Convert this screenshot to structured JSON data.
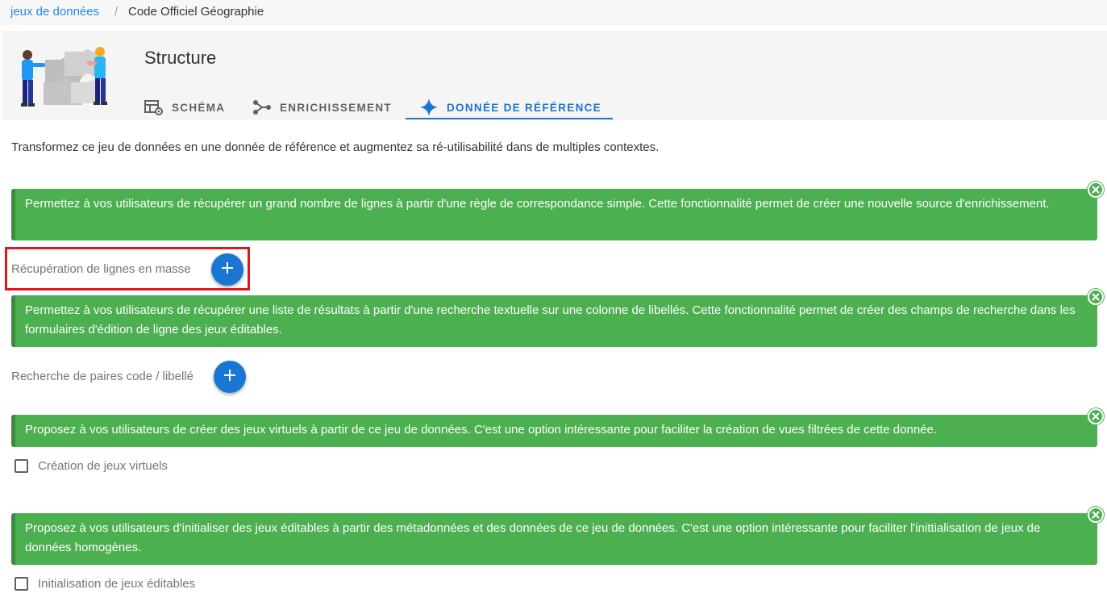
{
  "breadcrumb": {
    "parent": "jeux de données",
    "separator": "/",
    "current": "Code Officiel Géographie"
  },
  "header": {
    "title": "Structure",
    "illustration_icon": "puzzle-team-illustration",
    "tabs": [
      {
        "label": "SCHÉMA",
        "icon": "table-cog-icon",
        "active": false
      },
      {
        "label": "ENRICHISSEMENT",
        "icon": "source-branch-icon",
        "active": false
      },
      {
        "label": "DONNÉE DE RÉFÉRENCE",
        "icon": "star-four-points-icon",
        "active": true
      }
    ]
  },
  "intro": "Transformez ce jeu de données en une donnée de référence et augmentez sa ré-utilisabilité dans de multiples contextes.",
  "sections": [
    {
      "alert": "Permettez à vos utilisateurs de récupérer un grand nombre de lignes à partir d'une règle de correspondance simple. Cette fonctionnalité permet de créer une nouvelle source d'enrichissement.",
      "label": "Récupération de lignes en masse",
      "control": "add-button"
    },
    {
      "alert": "Permettez à vos utilisateurs de récupérer une liste de résultats à partir d'une recherche textuelle sur une colonne de libellés. Cette fonctionnalité permet de créer des champs de recherche dans les formulaires d'édition de ligne des jeux éditables.",
      "label": "Recherche de paires code / libellé",
      "control": "add-button"
    },
    {
      "alert": "Proposez à vos utilisateurs de créer des jeux virtuels à partir de ce jeu de données. C'est une option intéressante pour faciliter la création de vues filtrées de cette donnée.",
      "label": "Création de jeux virtuels",
      "control": "checkbox",
      "checked": false
    },
    {
      "alert": "Proposez à vos utilisateurs d'initialiser des jeux éditables à partir des métadonnées et des données de ce jeu de données. C'est une option intéressante pour faciliter l'inittialisation de jeux de données homogènes.",
      "label": "Initialisation de jeux éditables",
      "control": "checkbox",
      "checked": false
    }
  ],
  "colors": {
    "accent": "#1976d2",
    "alert_bg": "#4caf50",
    "highlight": "#e0161b"
  }
}
